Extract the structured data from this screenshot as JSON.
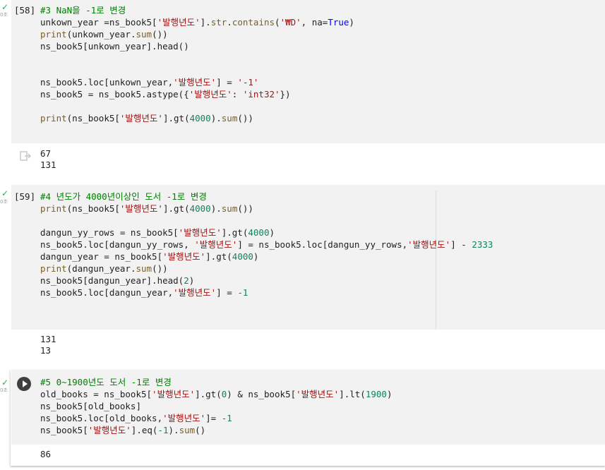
{
  "cells": [
    {
      "exec_count": "[58]",
      "status": "✓",
      "duration": "0초",
      "code": [
        [
          {
            "t": "#3 NaN을 -1로 변경",
            "c": "cm"
          }
        ],
        [
          {
            "t": "unkown_year =ns_book5[",
            "c": ""
          },
          {
            "t": "'발행년도'",
            "c": "st"
          },
          {
            "t": "].",
            "c": ""
          },
          {
            "t": "str",
            "c": "fn"
          },
          {
            "t": ".",
            "c": ""
          },
          {
            "t": "contains",
            "c": "fn"
          },
          {
            "t": "(",
            "c": ""
          },
          {
            "t": "'₩D'",
            "c": "st"
          },
          {
            "t": ", na=",
            "c": ""
          },
          {
            "t": "True",
            "c": "kw"
          },
          {
            "t": ")",
            "c": ""
          }
        ],
        [
          {
            "t": "print",
            "c": "fn"
          },
          {
            "t": "(unkown_year.",
            "c": ""
          },
          {
            "t": "sum",
            "c": "fn"
          },
          {
            "t": "())",
            "c": ""
          }
        ],
        [
          {
            "t": "ns_book5[unkown_year].head()",
            "c": ""
          }
        ],
        [],
        [],
        [
          {
            "t": "ns_book5.loc[unkown_year,",
            "c": ""
          },
          {
            "t": "'발행년도'",
            "c": "st"
          },
          {
            "t": "] = ",
            "c": ""
          },
          {
            "t": "'-1'",
            "c": "st"
          }
        ],
        [
          {
            "t": "ns_book5 = ns_book5.astype({",
            "c": ""
          },
          {
            "t": "'발행년도'",
            "c": "st"
          },
          {
            "t": ": ",
            "c": ""
          },
          {
            "t": "'int32'",
            "c": "st"
          },
          {
            "t": "})",
            "c": ""
          }
        ],
        [],
        [
          {
            "t": "print",
            "c": "fn"
          },
          {
            "t": "(ns_book5[",
            "c": ""
          },
          {
            "t": "'발행년도'",
            "c": "st"
          },
          {
            "t": "].gt(",
            "c": ""
          },
          {
            "t": "4000",
            "c": "nu"
          },
          {
            "t": ").",
            "c": ""
          },
          {
            "t": "sum",
            "c": "fn"
          },
          {
            "t": "())",
            "c": ""
          }
        ]
      ],
      "output": [
        "67",
        "131"
      ]
    },
    {
      "exec_count": "[59]",
      "status": "✓",
      "duration": "0초",
      "code": [
        [
          {
            "t": "#4 년도가 4000년이상인 도서 -1로 변경",
            "c": "cm"
          }
        ],
        [
          {
            "t": "print",
            "c": "fn"
          },
          {
            "t": "(ns_book5[",
            "c": ""
          },
          {
            "t": "'발행년도'",
            "c": "st"
          },
          {
            "t": "].gt(",
            "c": ""
          },
          {
            "t": "4000",
            "c": "nu"
          },
          {
            "t": ").",
            "c": ""
          },
          {
            "t": "sum",
            "c": "fn"
          },
          {
            "t": "())",
            "c": ""
          }
        ],
        [],
        [
          {
            "t": "dangun_yy_rows = ns_book5[",
            "c": ""
          },
          {
            "t": "'발행년도'",
            "c": "st"
          },
          {
            "t": "].gt(",
            "c": ""
          },
          {
            "t": "4000",
            "c": "nu"
          },
          {
            "t": ")",
            "c": ""
          }
        ],
        [
          {
            "t": "ns_book5.loc[dangun_yy_rows, ",
            "c": ""
          },
          {
            "t": "'발행년도'",
            "c": "st"
          },
          {
            "t": "] = ns_book5.loc[dangun_yy_rows,",
            "c": ""
          },
          {
            "t": "'발행년도'",
            "c": "st"
          },
          {
            "t": "] - ",
            "c": ""
          },
          {
            "t": "2333",
            "c": "nu"
          }
        ],
        [
          {
            "t": "dangun_year = ns_book5[",
            "c": ""
          },
          {
            "t": "'발행년도'",
            "c": "st"
          },
          {
            "t": "].gt(",
            "c": ""
          },
          {
            "t": "4000",
            "c": "nu"
          },
          {
            "t": ")",
            "c": ""
          }
        ],
        [
          {
            "t": "print",
            "c": "fn"
          },
          {
            "t": "(dangun_year.",
            "c": ""
          },
          {
            "t": "sum",
            "c": "fn"
          },
          {
            "t": "())",
            "c": ""
          }
        ],
        [
          {
            "t": "ns_book5[dangun_year].head(",
            "c": ""
          },
          {
            "t": "2",
            "c": "nu"
          },
          {
            "t": ")",
            "c": ""
          }
        ],
        [
          {
            "t": "ns_book5.loc[dangun_year,",
            "c": ""
          },
          {
            "t": "'발행년도'",
            "c": "st"
          },
          {
            "t": "] = ",
            "c": ""
          },
          {
            "t": "-1",
            "c": "nu"
          }
        ]
      ],
      "output": [
        "131",
        "13"
      ]
    },
    {
      "exec_count": "",
      "status": "✓",
      "duration": "0초",
      "code": [
        [
          {
            "t": "#5 0~1900년도 도서 -1로 변경",
            "c": "cm"
          }
        ],
        [
          {
            "t": "old_books = ns_book5[",
            "c": ""
          },
          {
            "t": "'발행년도'",
            "c": "st"
          },
          {
            "t": "].gt(",
            "c": ""
          },
          {
            "t": "0",
            "c": "nu"
          },
          {
            "t": ") & ns_book5[",
            "c": ""
          },
          {
            "t": "'발행년도'",
            "c": "st"
          },
          {
            "t": "].lt(",
            "c": ""
          },
          {
            "t": "1900",
            "c": "nu"
          },
          {
            "t": ")",
            "c": ""
          }
        ],
        [
          {
            "t": "ns_book5[old_books]",
            "c": ""
          }
        ],
        [
          {
            "t": "ns_book5.loc[old_books,",
            "c": ""
          },
          {
            "t": "'발행년도'",
            "c": "st"
          },
          {
            "t": "]= ",
            "c": ""
          },
          {
            "t": "-1",
            "c": "nu"
          }
        ],
        [
          {
            "t": "ns_book5[",
            "c": ""
          },
          {
            "t": "'발행년도'",
            "c": "st"
          },
          {
            "t": "].eq(",
            "c": ""
          },
          {
            "t": "-1",
            "c": "nu"
          },
          {
            "t": ").",
            "c": ""
          },
          {
            "t": "sum",
            "c": "fn"
          },
          {
            "t": "()",
            "c": ""
          }
        ]
      ],
      "output": [
        "86"
      ]
    }
  ],
  "icons": {
    "run": "play-circle-icon",
    "output": "output-arrow-icon"
  },
  "colors": {
    "comment": "#008000",
    "string": "#a31515",
    "number": "#098658",
    "function": "#795e26",
    "keyword": "#0000ff",
    "code_bg": "#f2f2f2",
    "success_check": "#34a853"
  }
}
